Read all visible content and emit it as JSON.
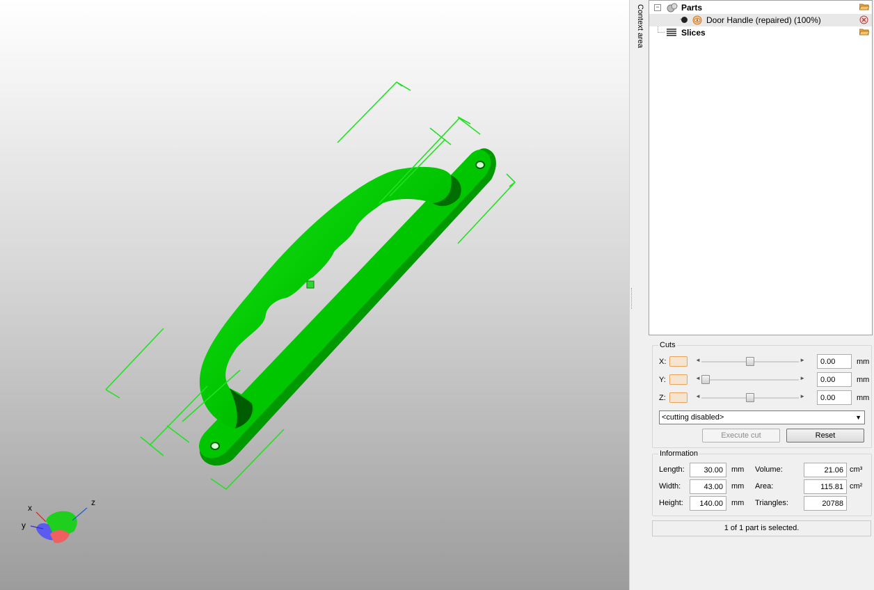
{
  "viewport": {
    "model_color": "#00c800",
    "axes": {
      "x": "x",
      "y": "y",
      "z": "z"
    }
  },
  "context_area_label": "Context area",
  "tree": {
    "parts_label": "Parts",
    "part_item_label": "Door Handle (repaired) (100%)",
    "slices_label": "Slices"
  },
  "cuts": {
    "title": "Cuts",
    "x_label": "X:",
    "y_label": "Y:",
    "z_label": "Z:",
    "x_value": "0.00",
    "y_value": "0.00",
    "z_value": "0.00",
    "unit": "mm",
    "x_slider_pos": 0.5,
    "y_slider_pos": 0.0,
    "z_slider_pos": 0.5,
    "mode_selected": "<cutting disabled>",
    "execute_label": "Execute cut",
    "reset_label": "Reset"
  },
  "information": {
    "title": "Information",
    "length_label": "Length:",
    "length_value": "30.00",
    "width_label": "Width:",
    "width_value": "43.00",
    "height_label": "Height:",
    "height_value": "140.00",
    "mm": "mm",
    "volume_label": "Volume:",
    "volume_value": "21.06",
    "volume_unit": "cm³",
    "area_label": "Area:",
    "area_value": "115.81",
    "area_unit": "cm²",
    "triangles_label": "Triangles:",
    "triangles_value": "20788"
  },
  "status": "1 of 1 part is selected."
}
